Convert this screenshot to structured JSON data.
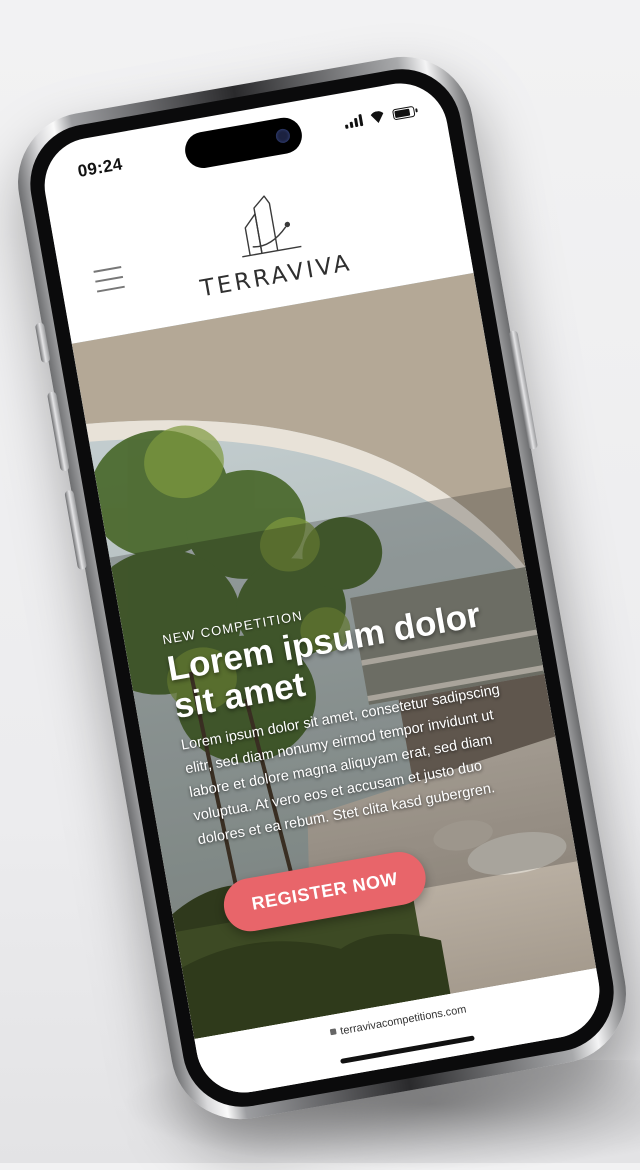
{
  "status": {
    "time": "09:24"
  },
  "brand": {
    "name": "TERRAVIVA"
  },
  "hero": {
    "kicker": "NEW COMPETITION",
    "headline": "Lorem ipsum dolor sit amet",
    "body": "Lorem ipsum dolor sit amet, consetetur sadipscing elitr, sed diam nonumy eirmod tempor invidunt ut labore et dolore magna aliquyam erat, sed diam voluptua. At vero eos et accusam et justo duo dolores et ea rebum. Stet clita kasd gubergren.",
    "cta_label": "REGISTER NOW"
  },
  "browser": {
    "url": "terravivacompetitions.com"
  },
  "colors": {
    "cta": "#e8656a",
    "logo_text": "#2f2f2f"
  },
  "icons": [
    "menu-icon",
    "signal-icon",
    "wifi-icon",
    "battery-icon",
    "lock-icon"
  ]
}
